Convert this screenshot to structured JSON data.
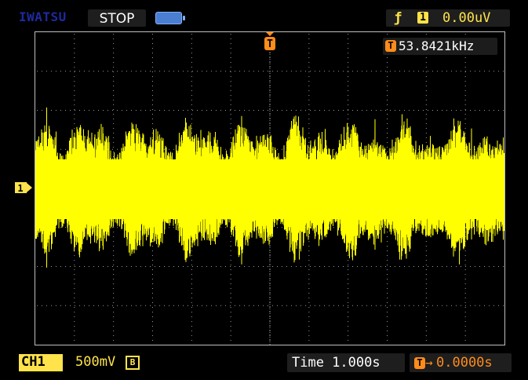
{
  "header": {
    "brand": "IWATSU",
    "run_status": "STOP",
    "battery_icon": "battery-icon",
    "trigger": {
      "edge_symbol": "ƒ",
      "edge_icon": "rising-edge-icon",
      "source_channel": "1",
      "level": "0.00uV"
    }
  },
  "screen": {
    "grid_divisions": {
      "horizontal": 12,
      "vertical": 8
    },
    "trigger_marker_label": "T",
    "frequency_badge": "T",
    "frequency": "53.8421kHz",
    "channel_marker": "1"
  },
  "footer": {
    "channel_label": "CH1",
    "coupling_icon": "dc-coupling-icon",
    "volts_per_div": "500mV",
    "bandwidth_limit": "B",
    "timebase": "Time 1.000s",
    "trigger_position_badge": "T",
    "trigger_position_arrow": "→",
    "trigger_position": "0.0000s"
  },
  "colors": {
    "trace": "#ffff00",
    "channel": "#ffe34a",
    "trigger": "#ff8c1a",
    "brand": "#1e2a9e",
    "grid": "#9a9a9a"
  }
}
